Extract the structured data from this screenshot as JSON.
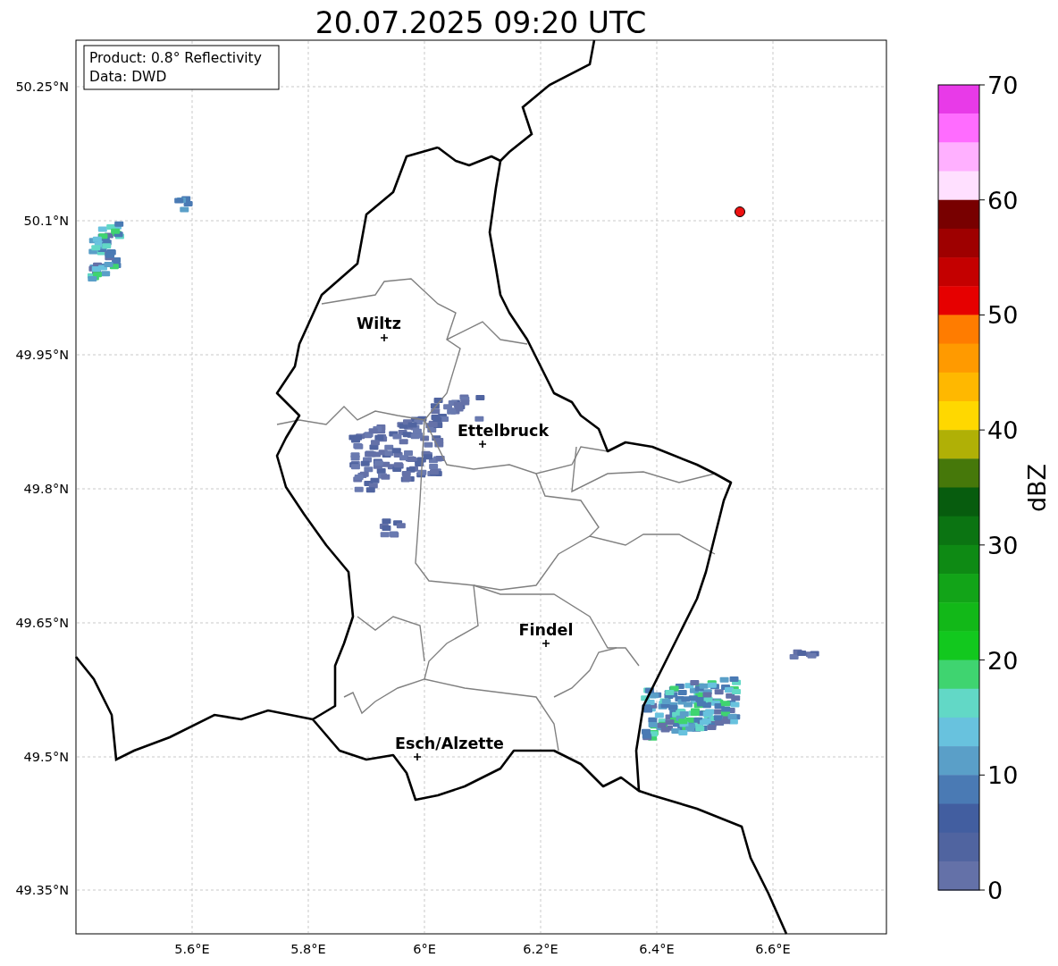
{
  "title": "20.07.2025 09:20 UTC",
  "info_box": [
    "Product: 0.8° Reflectivity",
    "Data: DWD"
  ],
  "lat_ticks": [
    "50.25°N",
    "50.1°N",
    "49.95°N",
    "49.8°N",
    "49.65°N",
    "49.5°N",
    "49.35°N"
  ],
  "lon_ticks": [
    "5.6°E",
    "5.8°E",
    "6°E",
    "6.2°E",
    "6.4°E",
    "6.6°E"
  ],
  "cities": [
    {
      "name": "Wiltz"
    },
    {
      "name": "Ettelbruck"
    },
    {
      "name": "Findel"
    },
    {
      "name": "Esch/Alzette"
    }
  ],
  "colorbar": {
    "label": "dBZ",
    "ticks": [
      "70",
      "60",
      "50",
      "40",
      "30",
      "20",
      "10",
      "0"
    ],
    "bands": [
      {
        "color": "#e83ae8"
      },
      {
        "color": "#ff6cff"
      },
      {
        "color": "#ffb0ff"
      },
      {
        "color": "#ffe0ff"
      },
      {
        "color": "#780000"
      },
      {
        "color": "#9e0000"
      },
      {
        "color": "#c40000"
      },
      {
        "color": "#e60000"
      },
      {
        "color": "#ff7c00"
      },
      {
        "color": "#ff9a00"
      },
      {
        "color": "#ffb800"
      },
      {
        "color": "#ffd800"
      },
      {
        "color": "#b0b006"
      },
      {
        "color": "#46780a"
      },
      {
        "color": "#075c0e"
      },
      {
        "color": "#0b7412"
      },
      {
        "color": "#0e8a14"
      },
      {
        "color": "#12a418"
      },
      {
        "color": "#12b818"
      },
      {
        "color": "#12c81e"
      },
      {
        "color": "#3fd470"
      },
      {
        "color": "#62d8c6"
      },
      {
        "color": "#68c2de"
      },
      {
        "color": "#5a9fc8"
      },
      {
        "color": "#4a7ab4"
      },
      {
        "color": "#425ea0"
      },
      {
        "color": "#5064a0"
      },
      {
        "color": "#6471a8"
      }
    ]
  }
}
